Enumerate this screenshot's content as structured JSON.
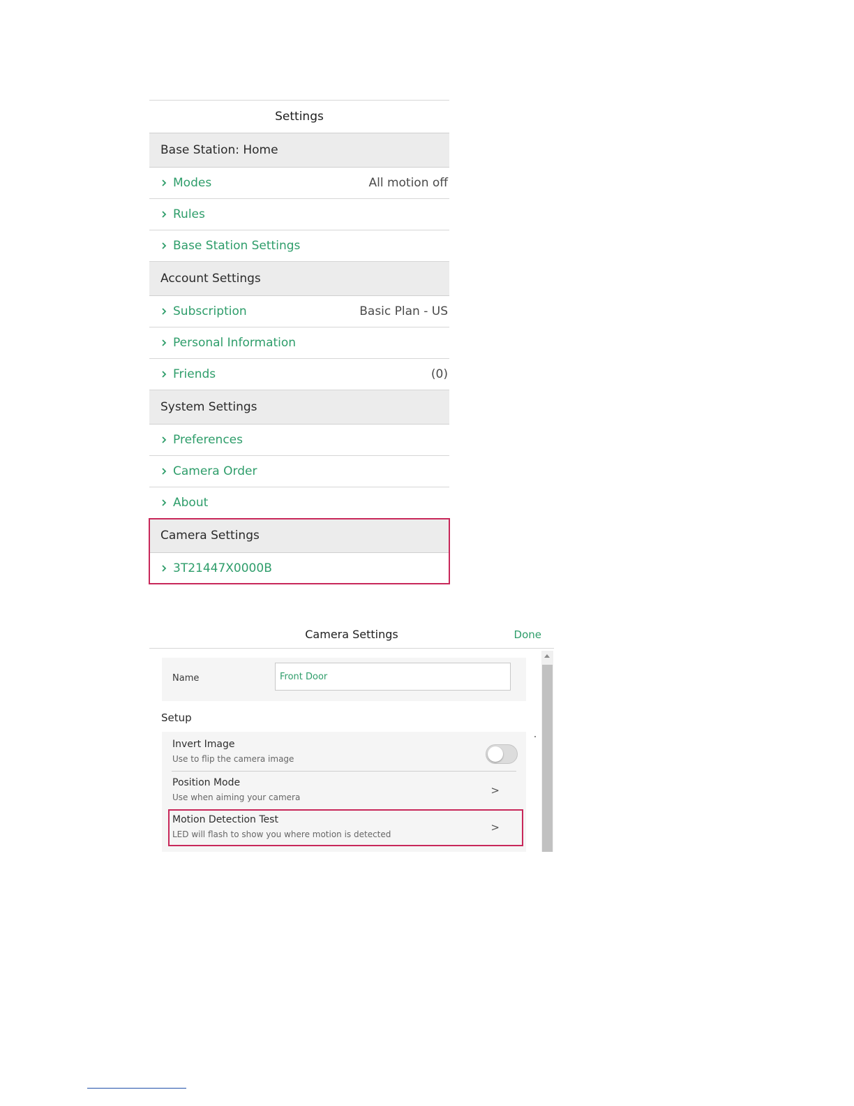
{
  "settings": {
    "title": "Settings",
    "sections": [
      {
        "header": "Base Station: Home",
        "items": [
          {
            "label": "Modes",
            "value": "All motion off"
          },
          {
            "label": "Rules",
            "value": ""
          },
          {
            "label": "Base Station Settings",
            "value": ""
          }
        ]
      },
      {
        "header": "Account Settings",
        "items": [
          {
            "label": "Subscription",
            "value": "Basic Plan - US"
          },
          {
            "label": "Personal Information",
            "value": ""
          },
          {
            "label": "Friends",
            "value": "(0)"
          }
        ]
      },
      {
        "header": "System Settings",
        "items": [
          {
            "label": "Preferences",
            "value": ""
          },
          {
            "label": "Camera Order",
            "value": ""
          },
          {
            "label": "About",
            "value": ""
          }
        ]
      },
      {
        "header": "Camera Settings",
        "items": [
          {
            "label": "3T21447X0000B",
            "value": ""
          }
        ]
      }
    ]
  },
  "camera_settings": {
    "title": "Camera Settings",
    "done_label": "Done",
    "name_label": "Name",
    "name_value": "Front Door",
    "setup_heading": "Setup",
    "rows": [
      {
        "title": "Invert Image",
        "subtitle": "Use to flip the camera image",
        "control": "toggle",
        "toggle_on": false
      },
      {
        "title": "Position Mode",
        "subtitle": "Use when aiming your camera",
        "control": "arrow",
        "arrow": ">"
      },
      {
        "title": "Motion Detection Test",
        "subtitle": "LED will flash to show you where motion is detected",
        "control": "arrow",
        "arrow": ">"
      }
    ]
  },
  "colors": {
    "accent_green": "#2e9d6a",
    "highlight_red": "#c8285a",
    "section_bg": "#ececec"
  },
  "icons": {
    "row_chevron": "chevron-right-icon"
  }
}
